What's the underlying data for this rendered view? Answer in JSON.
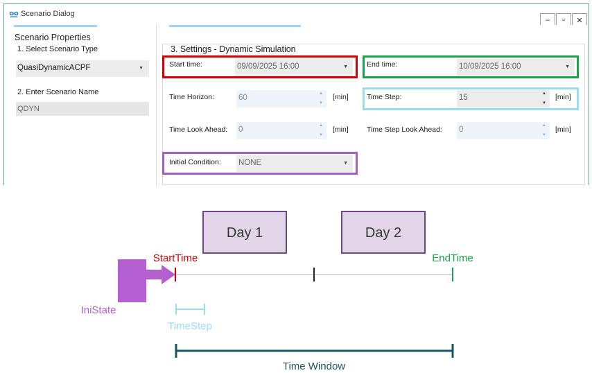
{
  "window": {
    "title": "Scenario Dialog",
    "icon": "infinity-logo-icon",
    "buttons": {
      "minimize": "–",
      "maximize": "▫",
      "close": "✕"
    }
  },
  "left_panel": {
    "title": "Scenario Properties",
    "type_label": "1. Select Scenario Type",
    "type_value": "QuasiDynamicACPF",
    "name_label": "2. Enter Scenario Name",
    "name_value": "QDYN"
  },
  "settings": {
    "title": "3. Settings - Dynamic Simulation",
    "start_time_label": "Start time:",
    "start_time_value": "09/09/2025 16:00",
    "end_time_label": "End time:",
    "end_time_value": "10/09/2025 16:00",
    "time_horizon_label": "Time Horizon:",
    "time_horizon_value": "60",
    "time_horizon_unit": "[min]",
    "time_step_label": "Time Step:",
    "time_step_value": "15",
    "time_step_unit": "[min]",
    "look_ahead_label": "Time Look Ahead:",
    "look_ahead_value": "0",
    "look_ahead_unit": "[min]",
    "step_look_ahead_label": "Time Step Look Ahead:",
    "step_look_ahead_value": "0",
    "step_look_ahead_unit": "[min]",
    "initial_condition_label": "Initial Condition:",
    "initial_condition_value": "NONE"
  },
  "diagram": {
    "day1": "Day 1",
    "day2": "Day 2",
    "start_label": "StartTime",
    "end_label": "EndTime",
    "inistate_label": "IniState",
    "timestep_label": "TimeStep",
    "window_label": "Time Window",
    "colors": {
      "start": "#d60000",
      "end": "#17a34a",
      "inistate": "#b35fd0",
      "timestep": "#99ddf3",
      "window": "#1a5560",
      "day_box_fill": "#e1d5e7",
      "day_box_border": "#6c4a85",
      "axis": "#d9d9d9"
    }
  }
}
